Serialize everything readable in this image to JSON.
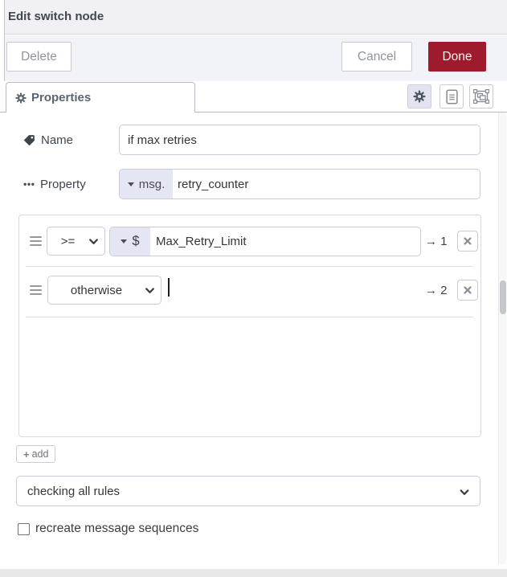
{
  "header": {
    "title": "Edit switch node"
  },
  "actions": {
    "delete_label": "Delete",
    "cancel_label": "Cancel",
    "done_label": "Done"
  },
  "tabs": {
    "properties_label": "Properties"
  },
  "form": {
    "name": {
      "label": "Name",
      "value": "if max retries",
      "placeholder": ""
    },
    "property": {
      "label": "Property",
      "type_prefix": "msg.",
      "value": "retry_counter"
    },
    "rules": [
      {
        "operator": ">=",
        "value_type_prefix": "$",
        "value": "Max_Retry_Limit",
        "output_label": "→ 1"
      },
      {
        "operator": "otherwise",
        "value": "",
        "output_label": "→ 2"
      }
    ],
    "add_button_label": "add",
    "mode_select_value": "checking all rules",
    "recreate_checkbox_label": "recreate message sequences",
    "recreate_checkbox_checked": false
  },
  "icons": {
    "plus": "+",
    "tag_icon": "tag",
    "property_icon": "ellipsis-dots",
    "gear_icon": "gear",
    "doc_icon": "document-lines",
    "group_icon": "object-group",
    "drag_icon": "hamburger-bars",
    "chevron_icon": "chevron-down",
    "remove_icon": "x-cross"
  },
  "colors": {
    "done_button_bg": "#9e1b2d",
    "type_prefix_bg": "#e5e6f3",
    "active_tool_bg": "#e2e2f0",
    "header_bg": "#f1f1f5",
    "buttonrow_bg": "#f2f2f9"
  }
}
